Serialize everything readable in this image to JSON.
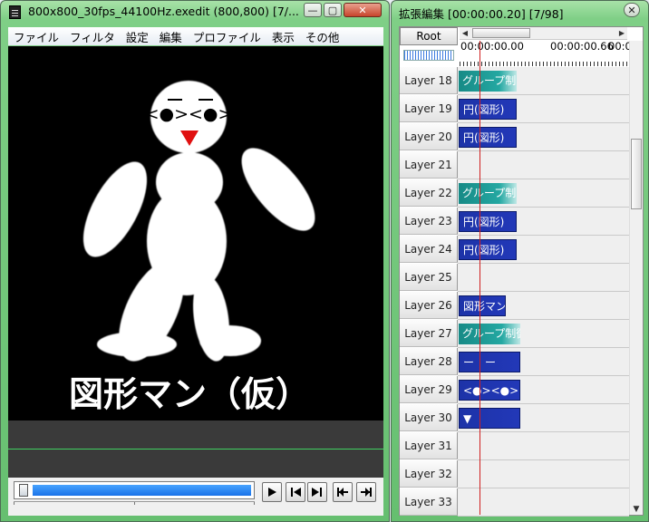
{
  "left_window": {
    "title": "800x800_30fps_44100Hz.exedit (800,800)  [7/...",
    "menu": [
      "ファイル",
      "フィルタ",
      "設定",
      "編集",
      "プロファイル",
      "表示",
      "その他"
    ],
    "canvas": {
      "face_text": "<●><●>",
      "caption": "図形マン（仮）"
    }
  },
  "right_window": {
    "title": "拡張編集 [00:00:00.20] [7/98]",
    "root_label": "Root",
    "time_start": "00:00:00.00",
    "time_mid": "00:00:00.66",
    "time_end": "00:0",
    "layers": [
      {
        "label": "Layer 18",
        "clip": "グループ制",
        "color": "teal",
        "width": 64
      },
      {
        "label": "Layer 19",
        "clip": "円(図形)",
        "color": "navy",
        "width": 64
      },
      {
        "label": "Layer 20",
        "clip": "円(図形)",
        "color": "navy",
        "width": 64
      },
      {
        "label": "Layer 21",
        "clip": null
      },
      {
        "label": "Layer 22",
        "clip": "グループ制",
        "color": "teal",
        "width": 64
      },
      {
        "label": "Layer 23",
        "clip": "円(図形)",
        "color": "navy",
        "width": 64
      },
      {
        "label": "Layer 24",
        "clip": "円(図形)",
        "color": "navy",
        "width": 64
      },
      {
        "label": "Layer 25",
        "clip": null
      },
      {
        "label": "Layer 26",
        "clip": "図形マン",
        "color": "navy",
        "width": 52
      },
      {
        "label": "Layer 27",
        "clip": "グループ制御",
        "color": "teal",
        "width": 68
      },
      {
        "label": "Layer 28",
        "clip": "ー　ー",
        "color": "navy",
        "width": 68
      },
      {
        "label": "Layer 29",
        "clip": "<●><●>",
        "color": "navy",
        "width": 68
      },
      {
        "label": "Layer 30",
        "clip": "▼",
        "color": "navy",
        "width": 68
      },
      {
        "label": "Layer 31",
        "clip": null
      },
      {
        "label": "Layer 32",
        "clip": null
      },
      {
        "label": "Layer 33",
        "clip": null
      }
    ]
  },
  "colors": {
    "window_frame": "#66bf70",
    "canvas_bg": "#000000",
    "clip_teal": "#24a8a2",
    "clip_navy": "#2238b8",
    "playhead": "#d02020",
    "nose": "#e01010"
  }
}
